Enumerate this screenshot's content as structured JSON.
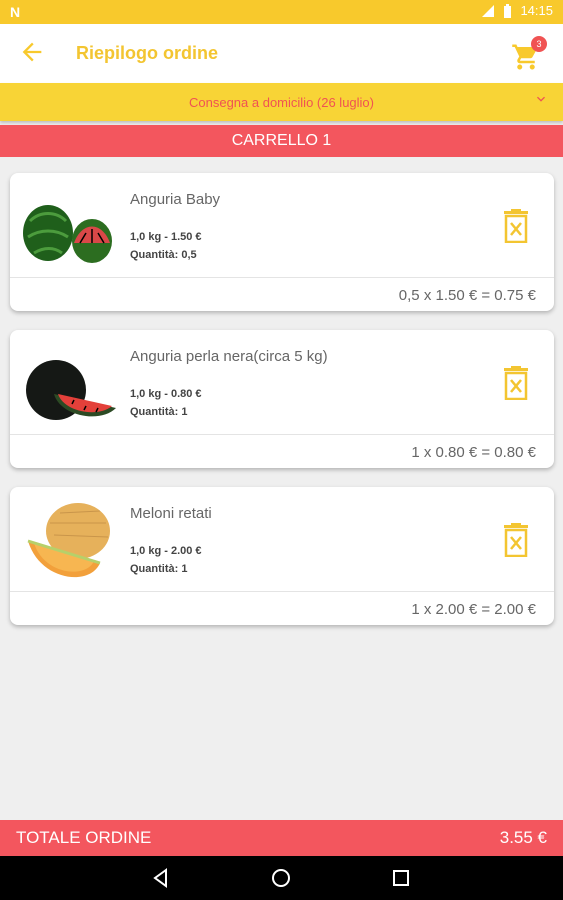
{
  "status_bar": {
    "time": "14:15",
    "left_icon": "N"
  },
  "app_bar": {
    "title": "Riepilogo ordine",
    "cart_count": "3"
  },
  "delivery": {
    "label": "Consegna a domicilio (26 luglio)"
  },
  "cart": {
    "header": "CARRELLO 1"
  },
  "items": [
    {
      "name": "Anguria Baby",
      "weight_price": "1,0 kg - 1.50 €",
      "quantity": "Quantità: 0,5",
      "subtotal": "0,5 x 1.50 € = 0.75 €"
    },
    {
      "name": "Anguria perla nera(circa 5 kg)",
      "weight_price": "1,0 kg - 0.80 €",
      "quantity": "Quantità: 1",
      "subtotal": "1 x 0.80 € = 0.80 €"
    },
    {
      "name": "Meloni retati",
      "weight_price": "1,0 kg - 2.00 €",
      "quantity": "Quantità: 1",
      "subtotal": "1 x 2.00 € = 2.00 €"
    }
  ],
  "total": {
    "label": "TOTALE ORDINE",
    "value": "3.55 €"
  },
  "colors": {
    "accent_yellow": "#f8c92c",
    "accent_red": "#f3565e"
  }
}
